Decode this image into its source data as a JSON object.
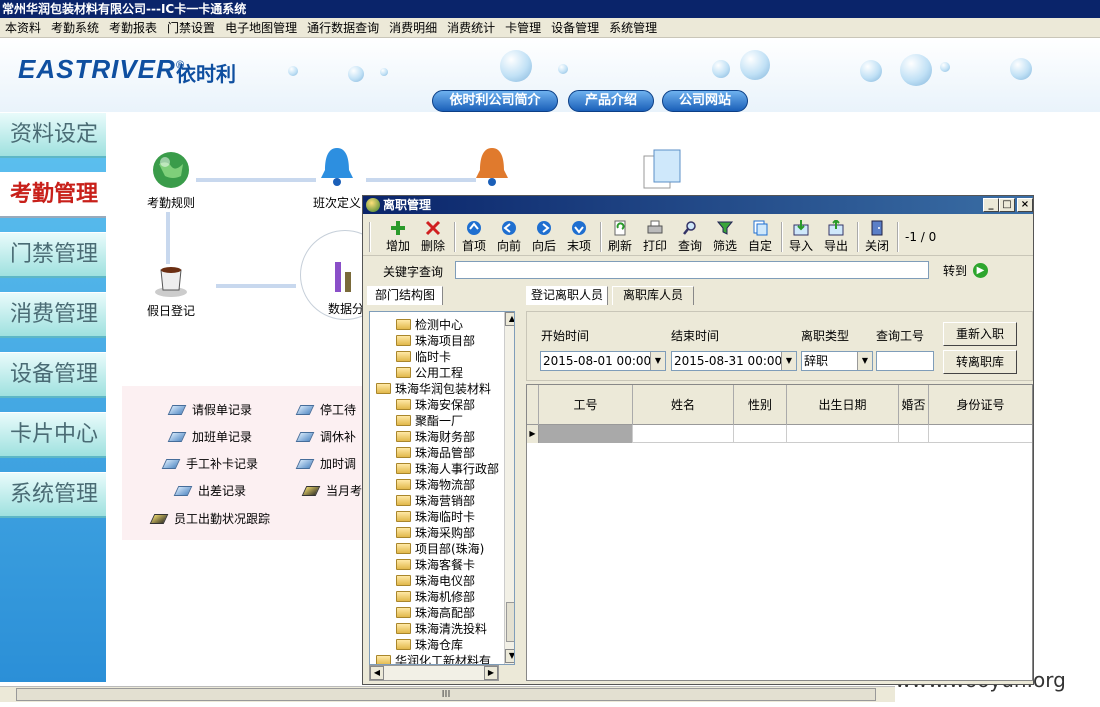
{
  "window": {
    "title": "常州华润包装材料有限公司---IC卡一卡通系统"
  },
  "menubar": [
    "本资料",
    "考勤系统",
    "考勤报表",
    "门禁设置",
    "电子地图管理",
    "通行数据查询",
    "消费明细",
    "消费统计",
    "卡管理",
    "设备管理",
    "系统管理"
  ],
  "banner": {
    "logo_text": "EASTRIVER",
    "logo_registered": "®",
    "logo_cn": "依时利",
    "buttons": [
      "依时利公司简介",
      "产品介绍",
      "公司网站"
    ]
  },
  "sidebar": [
    "资料设定",
    "考勤管理",
    "门禁管理",
    "消费管理",
    "设备管理",
    "卡片中心",
    "系统管理"
  ],
  "sidebar_active": "考勤管理",
  "flow": {
    "nodes": [
      "考勤规则",
      "班次定义",
      "假日登记",
      "数据分"
    ]
  },
  "links": [
    "请假单记录",
    "停工待",
    "加班单记录",
    "调休补",
    "手工补卡记录",
    "加时调",
    "出差记录",
    "当月考",
    "员工出勤状况跟踪"
  ],
  "dialog": {
    "title": "离职管理",
    "window_buttons": [
      "_",
      "□",
      "×"
    ],
    "toolbar": [
      "增加",
      "删除",
      "首项",
      "向前",
      "向后",
      "末项",
      "刷新",
      "打印",
      "查询",
      "筛选",
      "自定",
      "导入",
      "导出",
      "关闭"
    ],
    "record_counter": "-1 / 0",
    "keyword": {
      "label": "关键字查询",
      "value": "",
      "goto_label": "转到"
    },
    "left_tab": "部门结构图",
    "tabs": [
      "登记离职人员",
      "离职库人员"
    ],
    "tree": [
      {
        "label": "检测中心",
        "level": 2
      },
      {
        "label": "珠海项目部",
        "level": 2
      },
      {
        "label": "临时卡",
        "level": 2
      },
      {
        "label": "公用工程",
        "level": 2
      },
      {
        "label": "珠海华润包装材料",
        "level": 1
      },
      {
        "label": "珠海安保部",
        "level": 2
      },
      {
        "label": "聚酯一厂",
        "level": 2
      },
      {
        "label": "珠海财务部",
        "level": 2
      },
      {
        "label": "珠海品管部",
        "level": 2
      },
      {
        "label": "珠海人事行政部",
        "level": 2
      },
      {
        "label": "珠海物流部",
        "level": 2
      },
      {
        "label": "珠海营销部",
        "level": 2
      },
      {
        "label": "珠海临时卡",
        "level": 2
      },
      {
        "label": "珠海采购部",
        "level": 2
      },
      {
        "label": "项目部(珠海)",
        "level": 2
      },
      {
        "label": "珠海客餐卡",
        "level": 2
      },
      {
        "label": "珠海电仪部",
        "level": 2
      },
      {
        "label": "珠海机修部",
        "level": 2
      },
      {
        "label": "珠海高配部",
        "level": 2
      },
      {
        "label": "珠海清洗投料",
        "level": 2
      },
      {
        "label": "珠海仓库",
        "level": 2
      },
      {
        "label": "华润化工新材料有",
        "level": 1
      }
    ],
    "filter": {
      "start_label": "开始时间",
      "start_value": "2015-08-01 00:00",
      "end_label": "结束时间",
      "end_value": "2015-08-31 00:00",
      "type_label": "离职类型",
      "type_value": "辞职",
      "id_label": "查询工号",
      "id_value": "",
      "btn_reenter": "重新入职",
      "btn_transfer": "转离职库"
    },
    "grid": {
      "columns": [
        "工号",
        "姓名",
        "性别",
        "出生日期",
        "婚否",
        "身份证号"
      ],
      "row_indicator": "▶"
    }
  },
  "scroll_grip": "III",
  "watermark": "www.wooyun.org",
  "colors": {
    "title_bar": "#0a246a",
    "sidebar_active_text": "#c8201a",
    "banner_blue": "#0f4fa0"
  }
}
